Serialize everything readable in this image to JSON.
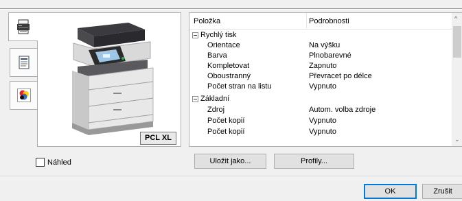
{
  "tabs": [
    {
      "icon": "printer-settings-icon",
      "active": true
    },
    {
      "icon": "document-icon",
      "active": false
    },
    {
      "icon": "color-circles-icon",
      "active": false
    }
  ],
  "preview": {
    "badge": "PCL XL",
    "checkbox_label": "Náhled",
    "checkbox_checked": false
  },
  "list": {
    "columns": [
      "Položka",
      "Podrobnosti"
    ],
    "groups": [
      {
        "label": "Rychlý tisk",
        "rows": [
          {
            "item": "Orientace",
            "detail": "Na výšku"
          },
          {
            "item": "Barva",
            "detail": "Plnobarevné"
          },
          {
            "item": "Kompletovat",
            "detail": "Zapnuto"
          },
          {
            "item": "Oboustranný",
            "detail": "Převracet po délce"
          },
          {
            "item": "Počet stran na listu",
            "detail": "Vypnuto"
          }
        ]
      },
      {
        "label": "Základní",
        "rows": [
          {
            "item": "Zdroj",
            "detail": "Autom. volba zdroje"
          },
          {
            "item": "Počet kopií",
            "detail": "Vypnuto"
          },
          {
            "item": "Počet kopií",
            "detail": "Vypnuto"
          }
        ]
      }
    ]
  },
  "buttons": {
    "save_as": "Uložit jako...",
    "profiles": "Profily...",
    "ok": "OK",
    "cancel": "Zrušit"
  },
  "colors": {
    "accent": "#0078d7",
    "window_bg": "#f0f0f0"
  }
}
